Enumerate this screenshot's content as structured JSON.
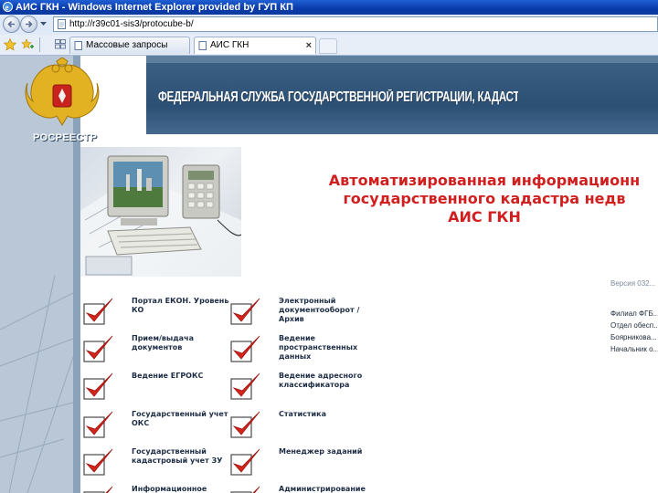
{
  "window": {
    "title": "АИС ГКН - Windows Internet Explorer provided by ГУП КП"
  },
  "address_bar": {
    "url": "http://r39c01-sis3/protocube-b/"
  },
  "tabs": [
    {
      "label": "Массовые запросы",
      "active": false
    },
    {
      "label": "АИС ГКН",
      "active": true
    }
  ],
  "header": {
    "agency_title": "ФЕДЕРАЛЬНАЯ СЛУЖБА ГОСУДАРСТВЕННОЙ РЕГИСТРАЦИИ, КАДАСТРА И КАРТОГРАФИИ",
    "logo_text": "РОСРЕЕСТР"
  },
  "system": {
    "line1": "Автоматизированная информационн",
    "line2": "государственного кадастра недв",
    "line3": "АИС ГКН"
  },
  "side_info": {
    "version": "Версия 032...",
    "lines": [
      "Филиал ФГБ...",
      "Отдел обесп...",
      "Боярникова...",
      "Начальник о..."
    ]
  },
  "menu": {
    "left": [
      {
        "label": "Портал ЕКОН. Уровень КО"
      },
      {
        "label": "Прием/выдача документов"
      },
      {
        "label": "Ведение ЕГРОКС"
      },
      {
        "label": "Государственный учет ОКС"
      },
      {
        "label": "Государственный кадастровый учет ЗУ"
      },
      {
        "label": "Информационное"
      }
    ],
    "right": [
      {
        "label": "Электронный документооборот / Архив"
      },
      {
        "label": "Ведение пространственных данных"
      },
      {
        "label": "Ведение адресного классификатора"
      },
      {
        "label": "Статистика"
      },
      {
        "label": "Менеджер заданий"
      },
      {
        "label": "Администрирование"
      }
    ]
  },
  "colors": {
    "accent_red": "#d11e1e",
    "header_blue": "#2c4f74",
    "menu_text": "#1e2d46"
  },
  "icons": [
    "ie-icon",
    "back-arrow-icon",
    "forward-arrow-icon",
    "page-icon",
    "favorites-star-icon",
    "add-favorites-icon",
    "tab-grid-icon",
    "red-checkmark-icon",
    "coat-of-arms-icon"
  ]
}
